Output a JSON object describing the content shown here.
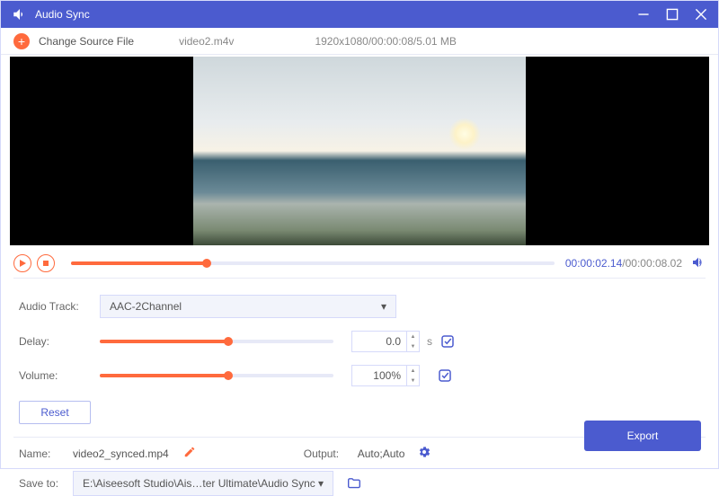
{
  "titlebar": {
    "title": "Audio Sync"
  },
  "toolbar": {
    "change_label": "Change Source File",
    "filename": "video2.m4v",
    "meta": "1920x1080/00:00:08/5.01 MB"
  },
  "player": {
    "current_time": "00:00:02.14",
    "total_time": "/00:00:08.02"
  },
  "controls": {
    "audio_track_label": "Audio Track:",
    "audio_track_value": "AAC-2Channel",
    "delay_label": "Delay:",
    "delay_value": "0.0",
    "delay_unit": "s",
    "volume_label": "Volume:",
    "volume_value": "100%",
    "reset_label": "Reset"
  },
  "output": {
    "name_label": "Name:",
    "name_value": "video2_synced.mp4",
    "output_label": "Output:",
    "output_value": "Auto;Auto",
    "saveto_label": "Save to:",
    "saveto_value": "E:\\Aiseesoft Studio\\Ais…ter Ultimate\\Audio Sync",
    "export_label": "Export"
  }
}
